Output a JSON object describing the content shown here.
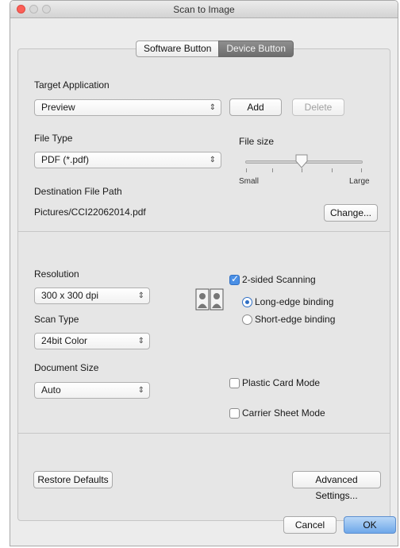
{
  "window": {
    "title": "Scan to Image"
  },
  "tabs": [
    {
      "label": "Software Button",
      "active": false
    },
    {
      "label": "Device Button",
      "active": true
    }
  ],
  "target_application": {
    "label": "Target Application",
    "value": "Preview",
    "add_label": "Add",
    "delete_label": "Delete"
  },
  "file_type": {
    "label": "File Type",
    "value": "PDF (*.pdf)"
  },
  "file_size": {
    "label": "File size",
    "min_label": "Small",
    "max_label": "Large",
    "level_fraction": 0.5
  },
  "destination": {
    "label": "Destination File Path",
    "value": "Pictures/CCI22062014.pdf",
    "change_label": "Change..."
  },
  "resolution": {
    "label": "Resolution",
    "value": "300 x 300 dpi"
  },
  "scan_type": {
    "label": "Scan Type",
    "value": "24bit Color"
  },
  "document_size": {
    "label": "Document Size",
    "value": "Auto"
  },
  "duplex": {
    "icon": "duplex-pages-icon",
    "label": "2-sided Scanning",
    "checked": true,
    "long_edge_label": "Long-edge binding",
    "short_edge_label": "Short-edge binding",
    "selected": "long-edge"
  },
  "plastic_card": {
    "label": "Plastic Card Mode",
    "checked": false
  },
  "carrier_sheet": {
    "label": "Carrier Sheet Mode",
    "checked": false
  },
  "footer": {
    "restore_label": "Restore Defaults",
    "advanced_label": "Advanced Settings...",
    "cancel_label": "Cancel",
    "ok_label": "OK"
  },
  "colors": {
    "accent": "#4a8fe5",
    "close_button": "#fc5f57",
    "active_tab": "#7c7c7c"
  }
}
